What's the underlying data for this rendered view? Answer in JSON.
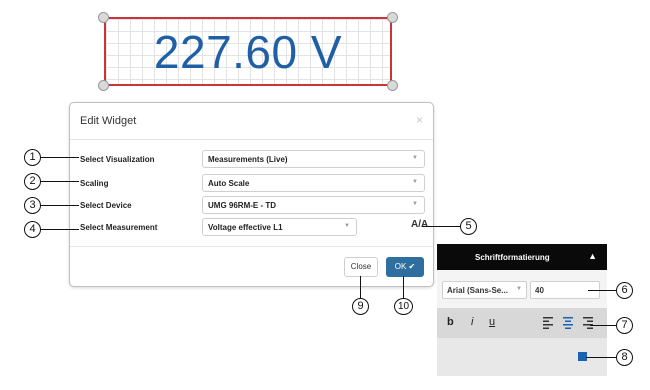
{
  "widget": {
    "value": "227.60 V"
  },
  "dialog": {
    "title": "Edit Widget",
    "close_x": "×",
    "fields": [
      {
        "label": "Select Visualization",
        "value": "Measurements (Live)"
      },
      {
        "label": "Scaling",
        "value": "Auto Scale"
      },
      {
        "label": "Select Device",
        "value": "UMG 96RM-E - TD"
      },
      {
        "label": "Select Measurement",
        "value": "Voltage effective L1"
      }
    ],
    "close_button": "Close",
    "ok_button": "OK ✔",
    "format_icon": "A/A"
  },
  "format_panel": {
    "title": "Schriftformatierung",
    "collapse_icon": "▲",
    "font_family": "Arial (Sans-Se...",
    "font_size": "40",
    "bold": "b",
    "italic": "i",
    "underline": "u",
    "color": "#1a62b0"
  },
  "callouts": [
    "1",
    "2",
    "3",
    "4",
    "5",
    "6",
    "7",
    "8",
    "9",
    "10"
  ]
}
